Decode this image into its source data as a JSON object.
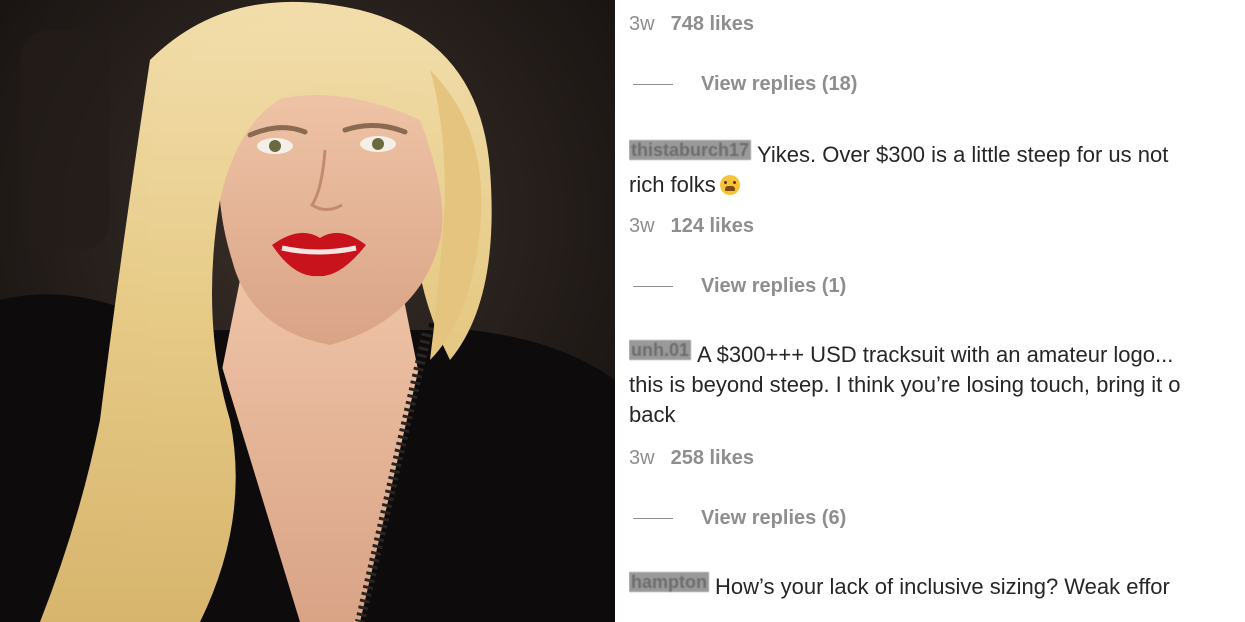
{
  "photo": {
    "subject": "portrait-photo"
  },
  "comments": {
    "top_meta": {
      "time": "3w",
      "likes": "748 likes"
    },
    "top_replies": "View replies (18)",
    "items": [
      {
        "username": "thistaburch17",
        "lines": [
          "Yikes. Over $300 is a little steep for us not",
          "rich folks"
        ],
        "time": "3w",
        "likes": "124 likes",
        "replies": "View replies (1)"
      },
      {
        "username": "unh.01",
        "lines": [
          "A $300+++ USD tracksuit with an amateur logo...",
          "this is beyond steep. I think you’re losing touch, bring it o",
          "back"
        ],
        "time": "3w",
        "likes": "258 likes",
        "replies": "View replies (6)"
      },
      {
        "username": "hampton",
        "lines": [
          "How’s your lack of inclusive sizing? Weak effor"
        ]
      }
    ]
  },
  "colors": {
    "text": "#262626",
    "muted": "#8e8e8e",
    "lipstick": "#c8121c",
    "hair": "#e8cf8f",
    "dress": "#0d0b0b"
  }
}
